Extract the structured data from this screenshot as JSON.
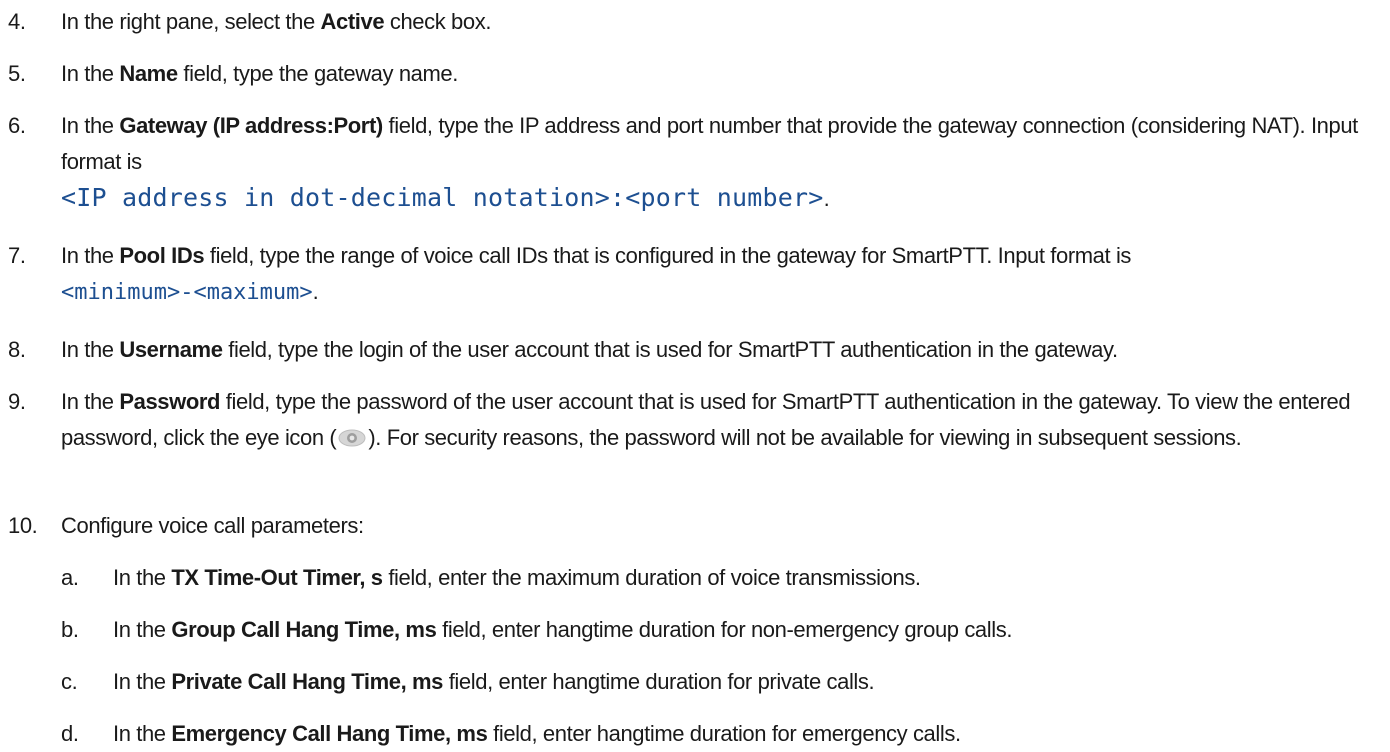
{
  "steps": {
    "s4": {
      "num": "4.",
      "t1": "In the right pane, select the ",
      "b1": "Active",
      "t2": " check box."
    },
    "s5": {
      "num": "5.",
      "t1": "In the ",
      "b1": "Name",
      "t2": " field, type the gateway name."
    },
    "s6": {
      "num": "6.",
      "t1": "In the ",
      "b1": "Gateway (IP address:Port)",
      "t2": " field, type the IP address and port number that provide the gateway connection (considering NAT). Input format is",
      "code": "<IP address in dot-decimal notation>:<port number>",
      "end": "."
    },
    "s7": {
      "num": "7.",
      "t1": "In the ",
      "b1": "Pool IDs",
      "t2": " field, type the range of voice call IDs that is configured in the gateway for SmartPTT. Input format is",
      "code": "<minimum>-<maximum>",
      "end": "."
    },
    "s8": {
      "num": "8.",
      "t1": "In the ",
      "b1": "Username",
      "t2": " field, type the login of the user account that is used for SmartPTT authentication in the gateway."
    },
    "s9": {
      "num": "9.",
      "t1": "In the ",
      "b1": "Password",
      "t2": " field, type the password of the user account that is used for SmartPTT authentication in the gateway. To view the entered password, click the eye icon (",
      "t3": "). For security reasons, the password will not be available for viewing in subsequent sessions.",
      "icon": "eye-icon"
    },
    "s10": {
      "num": "10.",
      "t1": "Configure voice call parameters:"
    }
  },
  "substeps": {
    "a": {
      "num": "a.",
      "t1": "In the ",
      "b1": "TX Time-Out Timer, s",
      "t2": " field, enter the maximum duration of voice transmissions."
    },
    "b": {
      "num": "b.",
      "t1": "In the ",
      "b1": "Group Call Hang Time, ms",
      "t2": " field, enter hangtime duration for non-emergency group calls."
    },
    "c": {
      "num": "c.",
      "t1": "In the ",
      "b1": "Private Call Hang Time, ms",
      "t2": " field, enter hangtime duration for private calls."
    },
    "d": {
      "num": "d.",
      "t1": "In the ",
      "b1": "Emergency Call Hang Time, ms",
      "t2": " field, enter hangtime duration for emergency calls."
    }
  }
}
